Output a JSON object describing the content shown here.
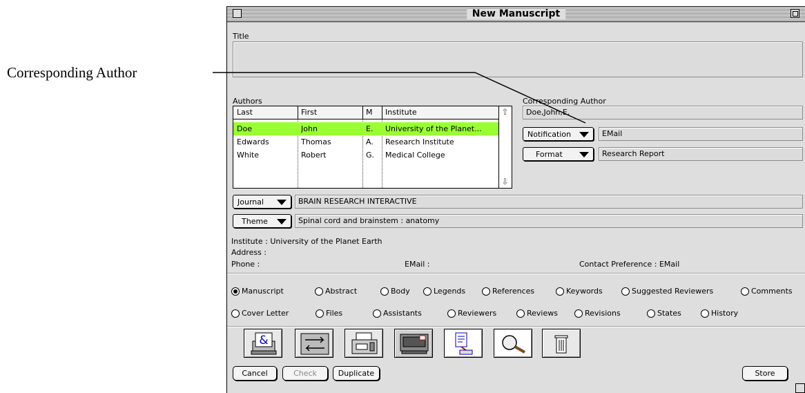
{
  "annotation": {
    "label": "Corresponding Author"
  },
  "window": {
    "title": "New Manuscript"
  },
  "title_section": {
    "label": "Title",
    "value": ""
  },
  "authors": {
    "label": "Authors",
    "columns": [
      "Last",
      "First",
      "M",
      "Institute"
    ],
    "rows": [
      {
        "last": "Doe",
        "first": "John",
        "m": "E.",
        "institute": "University of the Planet...",
        "selected": true
      },
      {
        "last": "Edwards",
        "first": "Thomas",
        "m": "A.",
        "institute": "Research Institute",
        "selected": false
      },
      {
        "last": "White",
        "first": "Robert",
        "m": "G.",
        "institute": "Medical College",
        "selected": false
      }
    ],
    "selected_color": "#99ff33"
  },
  "corresponding": {
    "label": "Corresponding Author",
    "value": "Doe,John,E.",
    "notification_label": "Notification",
    "notification_value": "EMail",
    "format_label": "Format",
    "format_value": "Research Report"
  },
  "journal": {
    "label": "Journal",
    "value": "BRAIN RESEARCH INTERACTIVE"
  },
  "theme": {
    "label": "Theme",
    "value": "Spinal cord and brainstem : anatomy"
  },
  "info": {
    "institute": "Institute : University of the Planet Earth",
    "address": "Address :",
    "phone": "Phone :",
    "email": "EMail :",
    "contact": "Contact Preference : EMail"
  },
  "sections_row1": [
    "Manuscript",
    "Abstract",
    "Body",
    "Legends",
    "References",
    "Keywords",
    "Suggested Reviewers",
    "Comments"
  ],
  "sections_row2": [
    "Cover Letter",
    "Files",
    "Assistants",
    "Reviewers",
    "Reviews",
    "Revisions",
    "States",
    "History"
  ],
  "selected_section": "Manuscript",
  "toolbar": [
    "email-author-icon",
    "transfer-icon",
    "print-fax-icon",
    "mail-tray-icon",
    "document-export-icon",
    "search-magnifier-icon",
    "trash-icon"
  ],
  "buttons": {
    "cancel": "Cancel",
    "check": "Check",
    "duplicate": "Duplicate",
    "store": "Store"
  }
}
